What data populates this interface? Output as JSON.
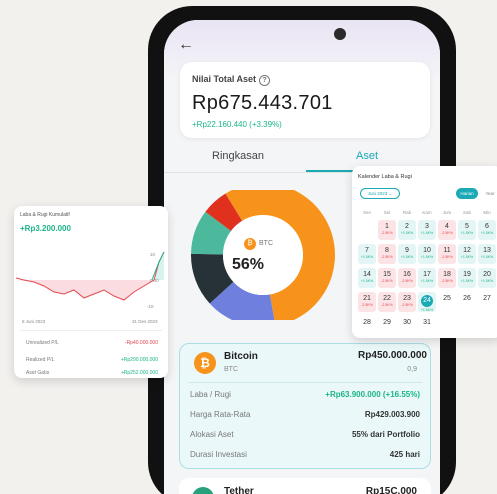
{
  "asset_card": {
    "label": "Nilai Total Aset",
    "help_icon": "question-circle-icon",
    "value": "Rp675.443.701",
    "change": "+Rp22.160.440 (+3.39%)"
  },
  "tabs": [
    {
      "label": "Ringkasan"
    },
    {
      "label": "Aset",
      "active": true
    }
  ],
  "donut": {
    "center_label": "BTC",
    "center_percent": "56%",
    "slices": [
      {
        "name": "BTC",
        "value": 56,
        "color": "#f7931a"
      },
      {
        "name": "",
        "value": 16,
        "color": "#6f7fde"
      },
      {
        "name": "",
        "value": 12,
        "color": "#263238"
      },
      {
        "name": "",
        "value": 10,
        "color": "#4cb89c"
      },
      {
        "name": "",
        "value": 6,
        "color": "#e0301e"
      }
    ]
  },
  "coin_card": {
    "name": "Bitcoin",
    "symbol": "BTC",
    "value": "Rp450.000.000",
    "amount": "0,9",
    "rows": [
      {
        "label": "Laba / Rugi",
        "value": "+Rp63.900.000 (+16.55%)"
      },
      {
        "label": "Harga Rata-Rata",
        "value": "Rp429.003.900"
      },
      {
        "label": "Alokasi Aset",
        "value": "55% dari Portfolio"
      },
      {
        "label": "Durasi Investasi",
        "value": "425 hari"
      }
    ]
  },
  "tether": {
    "name": "Tether",
    "value": "Rp15C.000"
  },
  "pl_card": {
    "title": "Laba & Rugi Kumulatif",
    "value": "+Rp3.200.000",
    "date_start": "8 Juni 2023",
    "date_end": "31 Des 2023",
    "axis": [
      "10",
      "0.00",
      "-10"
    ],
    "rows": [
      {
        "label": "Unrealized P/L",
        "value": "-Rp40.000.000"
      },
      {
        "label": "Realized P/L",
        "value": "+Rp290.000.000"
      },
      {
        "label": "Aset Gabs",
        "value": "+Rp252.000.000"
      }
    ]
  },
  "calendar": {
    "title": "Kalender Laba & Rugi",
    "month": "Juni 2023",
    "btn_monthly": "Harian",
    "btn_yearly": "Year",
    "dows": [
      "Sen",
      "Sel",
      "Rab",
      "Kam",
      "Jum",
      "Sab",
      "Min"
    ],
    "cells": [
      {
        "d": "",
        "p": "",
        "t": ""
      },
      {
        "d": "1",
        "p": "-2.5K%",
        "t": "neg"
      },
      {
        "d": "2",
        "p": "+1.5K%",
        "t": "pos"
      },
      {
        "d": "3",
        "p": "+1.5K%",
        "t": "pos"
      },
      {
        "d": "4",
        "p": "-2.5K%",
        "t": "neg"
      },
      {
        "d": "5",
        "p": "+1.5K%",
        "t": "pos"
      },
      {
        "d": "6",
        "p": "+1.5K%",
        "t": "pos"
      },
      {
        "d": "7",
        "p": "+1.5K%",
        "t": "pos"
      },
      {
        "d": "8",
        "p": "-2.5K%",
        "t": "neg"
      },
      {
        "d": "9",
        "p": "+1.5K%",
        "t": "pos"
      },
      {
        "d": "10",
        "p": "+1.5K%",
        "t": "pos"
      },
      {
        "d": "11",
        "p": "-2.5K%",
        "t": "neg"
      },
      {
        "d": "12",
        "p": "+1.5K%",
        "t": "pos"
      },
      {
        "d": "13",
        "p": "+1.5K%",
        "t": "pos"
      },
      {
        "d": "14",
        "p": "+1.5K%",
        "t": "pos"
      },
      {
        "d": "15",
        "p": "-2.5K%",
        "t": "neg"
      },
      {
        "d": "16",
        "p": "-2.5K%",
        "t": "neg"
      },
      {
        "d": "17",
        "p": "+1.5K%",
        "t": "pos"
      },
      {
        "d": "18",
        "p": "-2.5K%",
        "t": "neg"
      },
      {
        "d": "19",
        "p": "+1.5K%",
        "t": "pos"
      },
      {
        "d": "20",
        "p": "+1.5K%",
        "t": "pos"
      },
      {
        "d": "21",
        "p": "-2.5K%",
        "t": "neg"
      },
      {
        "d": "22",
        "p": "-2.5K%",
        "t": "neg"
      },
      {
        "d": "23",
        "p": "-2.5K%",
        "t": "neg"
      },
      {
        "d": "24",
        "p": "+1.5K%",
        "t": "pos today"
      },
      {
        "d": "25",
        "p": "",
        "t": ""
      },
      {
        "d": "26",
        "p": "",
        "t": ""
      },
      {
        "d": "27",
        "p": "",
        "t": ""
      },
      {
        "d": "28",
        "p": "",
        "t": ""
      },
      {
        "d": "29",
        "p": "",
        "t": ""
      },
      {
        "d": "30",
        "p": "",
        "t": ""
      },
      {
        "d": "31",
        "p": "",
        "t": ""
      }
    ]
  }
}
